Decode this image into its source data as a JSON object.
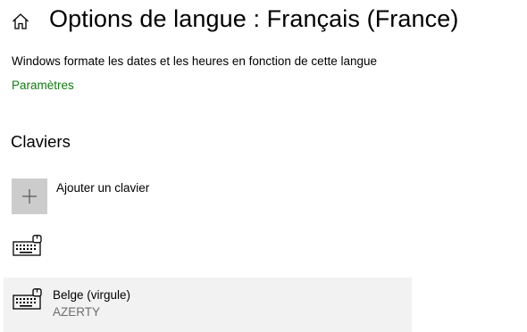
{
  "header": {
    "home_icon": "home-icon",
    "title": "Options de langue : Français (France)"
  },
  "main": {
    "description": "Windows formate les dates et les heures en fonction de cette langue",
    "settings_link": "Paramètres",
    "keyboards_section": {
      "heading": "Claviers",
      "add_keyboard_label": "Ajouter un clavier",
      "add_icon": "plus-icon",
      "keyboard_icon": "keyboard-icon",
      "items": [
        {
          "name": "Belge (virgule)",
          "layout": "AZERTY"
        }
      ]
    }
  },
  "colors": {
    "link": "#107c10",
    "tile": "#cccccc",
    "selected_row": "#f2f2f2",
    "secondary_text": "#6d6d6d"
  }
}
